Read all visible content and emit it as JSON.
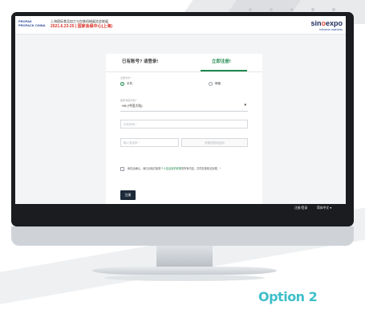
{
  "header": {
    "logo_line1": "PROPAK",
    "logo_line2": "PROPACK CHINA",
    "event_title": "上海国际食品加工与包装机械展览会联展",
    "event_date": "2021.6.23-25 | 国家会展中心(上海)",
    "brand_main_prefix": "sin",
    "brand_main_accent": "o",
    "brand_main_suffix": "expo",
    "brand_sub": "informa markets"
  },
  "tabs": {
    "login": "已有账号? 请登录!",
    "register": "立即注册!"
  },
  "form": {
    "method_label": "注册方式 *",
    "method_phone": "手机",
    "method_email": "邮箱",
    "country_label": "国家/地区代码 *",
    "country_value": "+86 (中国大陆)",
    "caret": "▾",
    "phone_placeholder": "手机号码 *",
    "code_placeholder": "输入验证码 *",
    "code_button": "获取短信验证码",
    "consent_prefix": "我在此确认，我已阅读并接受",
    "consent_link": "个人信息保护政策",
    "consent_suffix": "的所有内容，并同意被依法处理。*",
    "submit_label": "注册"
  },
  "footer": {
    "login_register": "注册/登录",
    "language": "简体中文 ▾"
  },
  "option_label": "Option 2",
  "colors": {
    "accent_green": "#1f8a4c",
    "date_red": "#d8342b",
    "option_teal": "#3dbfc9",
    "dark_button": "#1c2a3a"
  }
}
